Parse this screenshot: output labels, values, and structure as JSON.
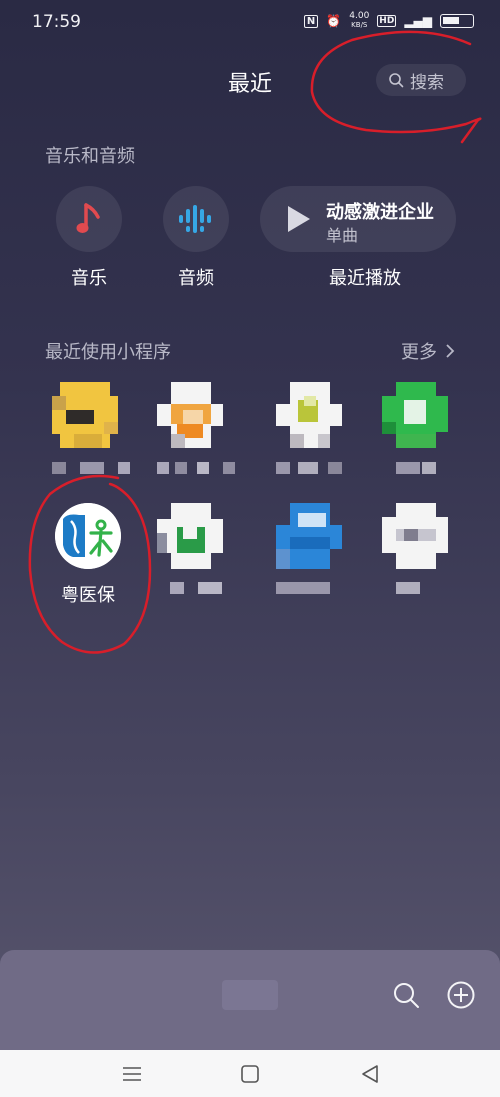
{
  "status_bar": {
    "time": "17:59",
    "nfc": "N",
    "net_speed_value": "4.00",
    "net_speed_unit": "KB/S",
    "hd": "HD"
  },
  "header": {
    "title": "最近",
    "search_label": "搜索"
  },
  "audio_section": {
    "title": "音乐和音频",
    "music_label": "音乐",
    "audio_label": "音频",
    "recent_title": "动感激进企业",
    "recent_subtitle": "单曲",
    "recent_label": "最近播放"
  },
  "mini_programs": {
    "title": "最近使用小程序",
    "more_label": "更多",
    "featured_label": "粤医保"
  },
  "colors": {
    "accent_red": "#e14a4f",
    "accent_blue": "#36a7e6",
    "background_top": "#2a2a44",
    "background_bottom": "#5b5870",
    "panel": "#706b86",
    "annotation_red": "#d81e2a"
  },
  "icons": {
    "music": "music-note-icon",
    "audio": "waveform-icon",
    "play": "play-icon",
    "search": "search-icon",
    "more": "chevron-right-icon",
    "add": "plus-circle-icon"
  }
}
